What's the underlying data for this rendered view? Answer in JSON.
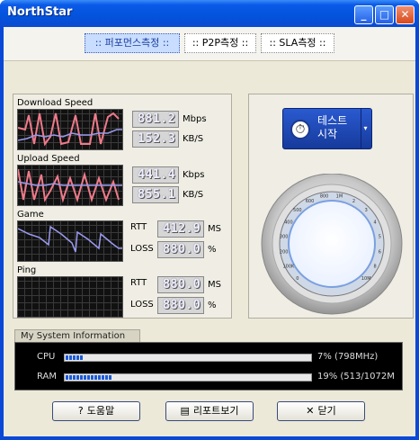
{
  "window": {
    "title": "NorthStar",
    "minimize_label": "_",
    "maximize_label": "□",
    "close_label": "✕"
  },
  "tabs": [
    {
      "label": ":: 퍼포먼스측정 ::",
      "active": true
    },
    {
      "label": ":: P2P측정 ::",
      "active": false
    },
    {
      "label": ":: SLA측정 ::",
      "active": false
    }
  ],
  "download": {
    "label": "Download Speed",
    "value1": "881.2",
    "unit1": "Mbps",
    "value2": "152.3",
    "unit2": "KB/S"
  },
  "upload": {
    "label": "Upload Speed",
    "value1": "441.4",
    "unit1": "Kbps",
    "value2": "855.1",
    "unit2": "KB/S"
  },
  "game": {
    "label": "Game",
    "rtt_label": "RTT",
    "rtt_value": "412.9",
    "rtt_unit": "MS",
    "loss_label": "LOSS",
    "loss_value": "880.0",
    "loss_unit": "%"
  },
  "ping": {
    "label": "Ping",
    "rtt_label": "RTT",
    "rtt_value": "880.0",
    "rtt_unit": "MS",
    "loss_label": "LOSS",
    "loss_value": "880.0",
    "loss_unit": "%"
  },
  "start_button": {
    "line1": "테스트",
    "line2": "시작",
    "icon": "stopwatch-icon"
  },
  "gauge": {
    "ticks": [
      "0",
      "100K",
      "200",
      "300",
      "400",
      "500",
      "600",
      "800",
      "1M",
      "2",
      "3",
      "4",
      "5",
      "6",
      "8",
      "10M"
    ]
  },
  "system_info": {
    "title": "My System Information",
    "cpu_label": "CPU",
    "cpu_value": "7% (798MHz)",
    "cpu_fraction": 0.07,
    "ram_label": "RAM",
    "ram_value": "19% (513/1072M",
    "ram_fraction": 0.19
  },
  "buttons": {
    "help": "도움말",
    "report": "리포트보기",
    "close": "닫기"
  },
  "colors": {
    "title_bar": "#0453dc",
    "accent": "#1a5ad8",
    "graph_bg": "#111111"
  }
}
